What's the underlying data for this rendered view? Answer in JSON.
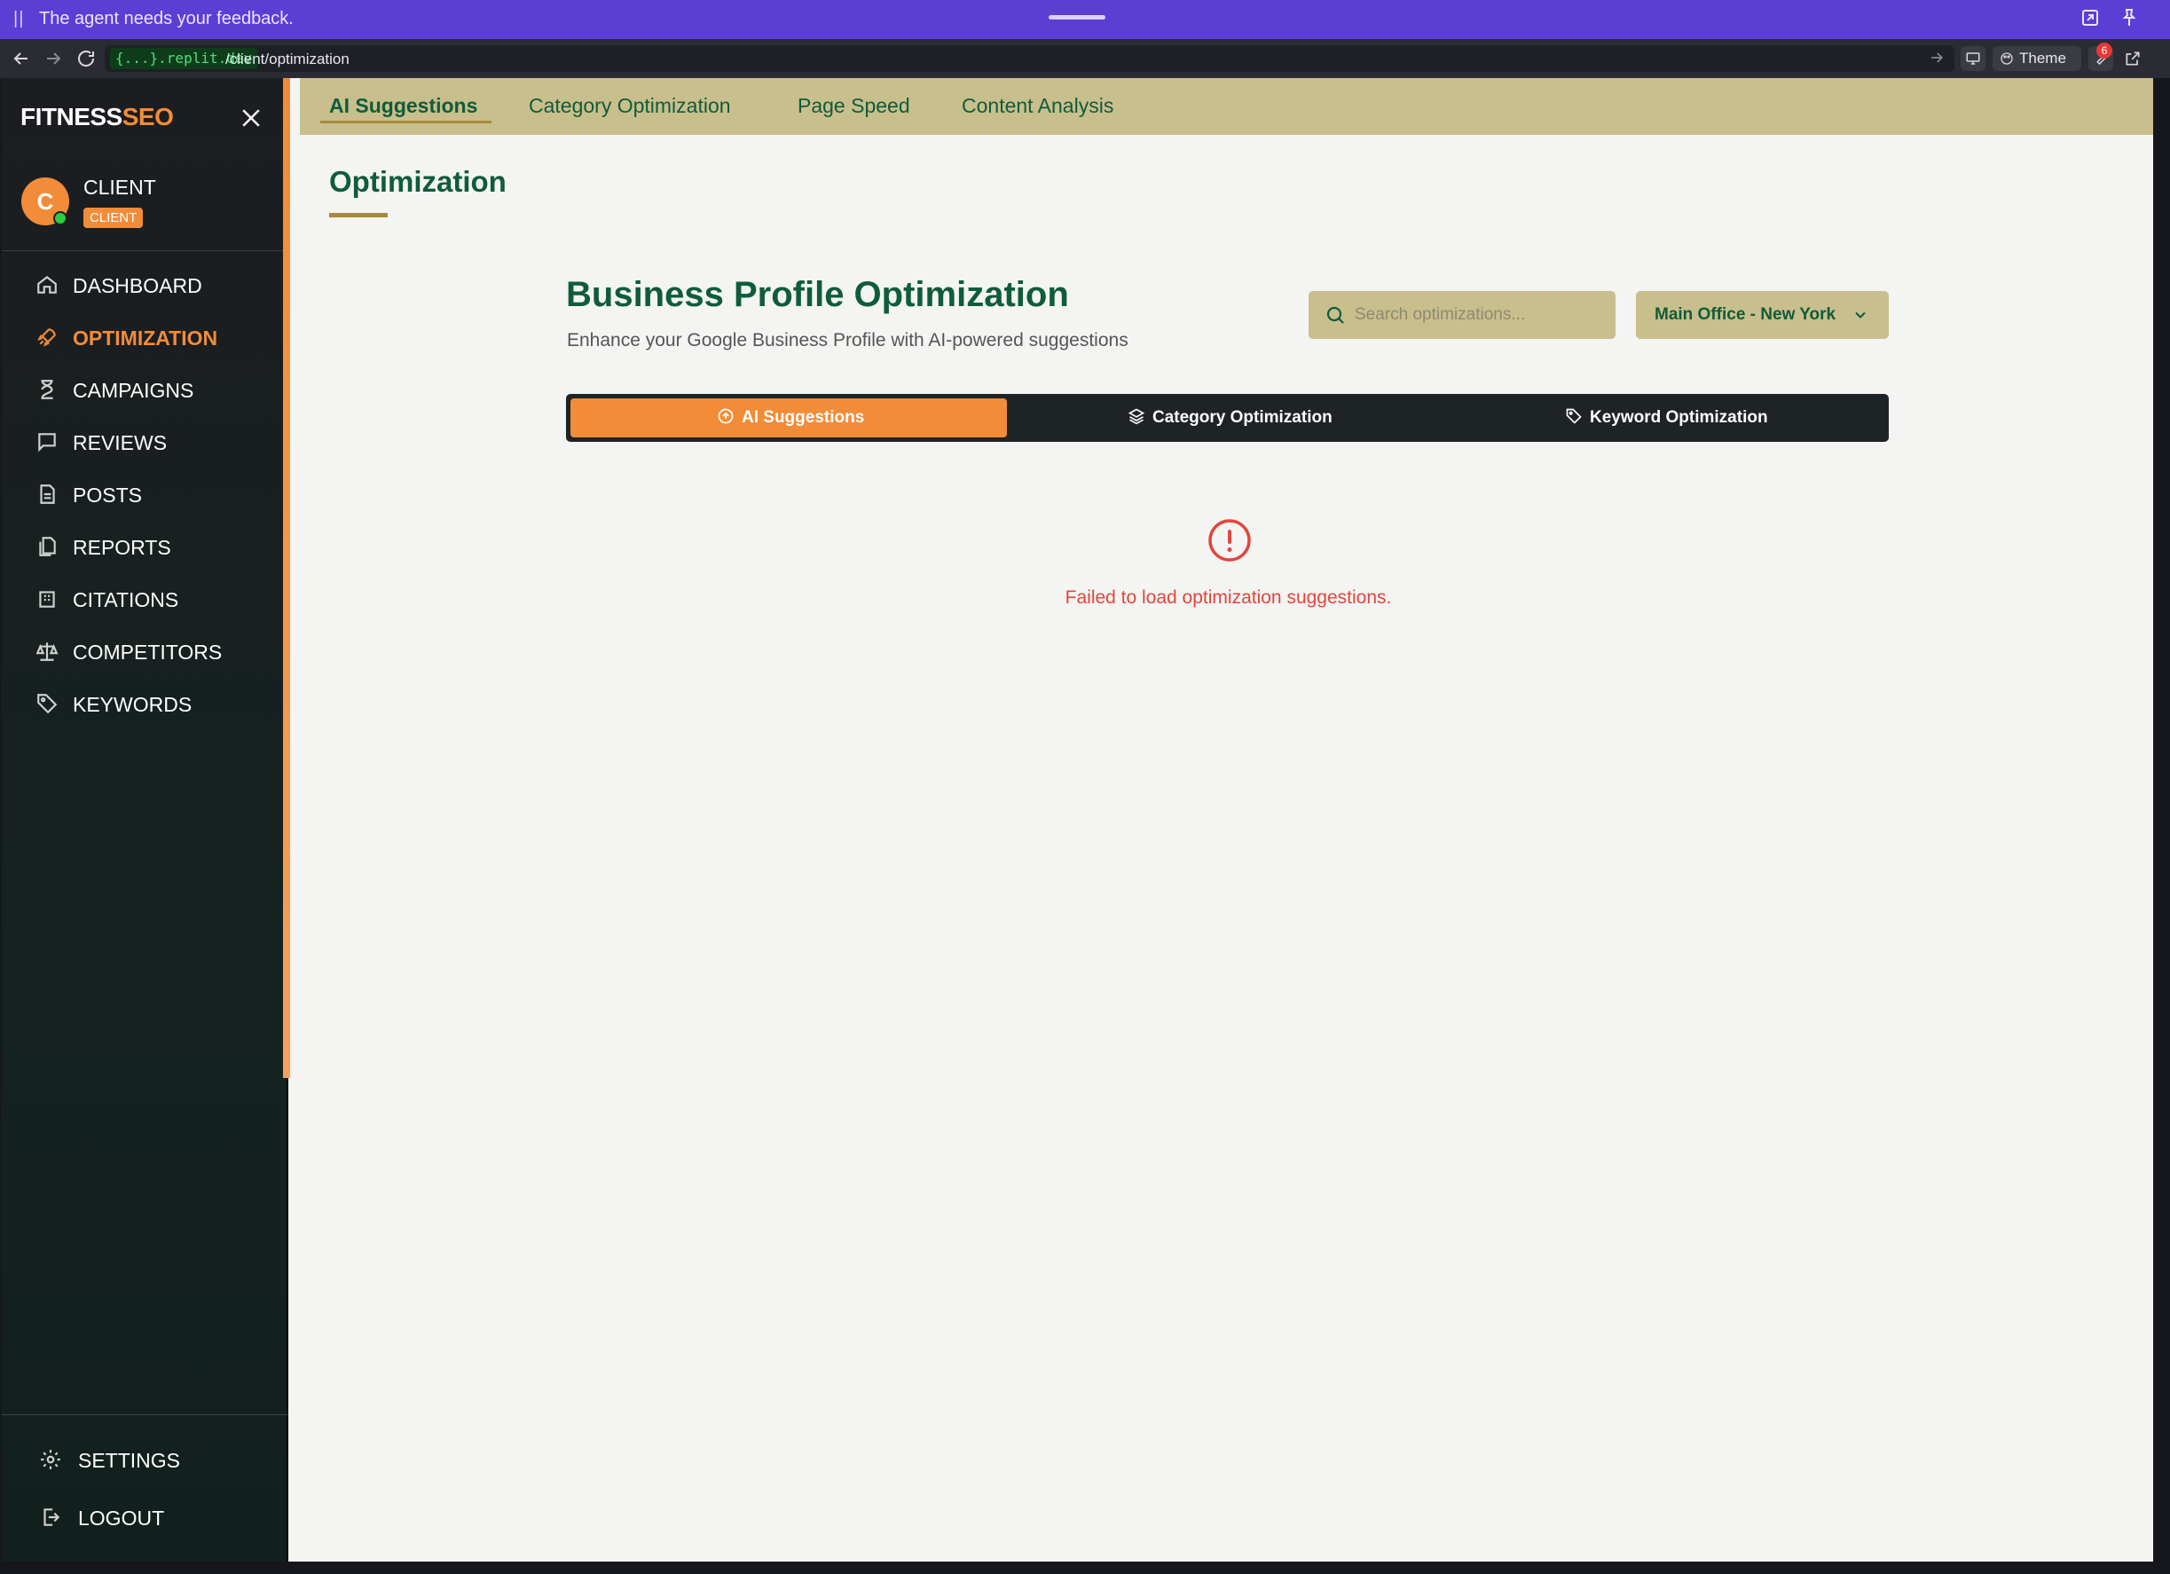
{
  "banner": {
    "message": "The agent needs your feedback."
  },
  "browser": {
    "host": "{...}.replit.dev",
    "path": "/client/optimization",
    "theme_label": "Theme",
    "notification_count": "6"
  },
  "sidebar": {
    "logo_part1": "FITNESS",
    "logo_part2": "SEO",
    "user": {
      "initial": "C",
      "name": "CLIENT",
      "role": "CLIENT"
    },
    "items": [
      {
        "label": "DASHBOARD",
        "icon": "home-icon"
      },
      {
        "label": "OPTIMIZATION",
        "icon": "rocket-icon",
        "active": true
      },
      {
        "label": "CAMPAIGNS",
        "icon": "hourglass-icon"
      },
      {
        "label": "REVIEWS",
        "icon": "message-icon"
      },
      {
        "label": "POSTS",
        "icon": "document-icon"
      },
      {
        "label": "REPORTS",
        "icon": "files-icon"
      },
      {
        "label": "CITATIONS",
        "icon": "building-icon"
      },
      {
        "label": "COMPETITORS",
        "icon": "scale-icon"
      },
      {
        "label": "KEYWORDS",
        "icon": "tag-icon"
      }
    ],
    "bottom": [
      {
        "label": "SETTINGS",
        "icon": "gear-icon"
      },
      {
        "label": "LOGOUT",
        "icon": "logout-icon"
      }
    ]
  },
  "top_tabs": [
    {
      "label": "AI Suggestions",
      "active": true
    },
    {
      "label": "Category Optimization"
    },
    {
      "label": "Page Speed"
    },
    {
      "label": "Content Analysis"
    }
  ],
  "page": {
    "title": "Optimization",
    "section_title": "Business Profile Optimization",
    "section_subtitle": "Enhance your Google Business Profile with AI-powered suggestions",
    "search_placeholder": "Search optimizations...",
    "location_selected": "Main Office - New York"
  },
  "segments": [
    {
      "label": "AI Suggestions",
      "icon": "arrow-up-circle-icon",
      "active": true
    },
    {
      "label": "Category Optimization",
      "icon": "layers-icon"
    },
    {
      "label": "Keyword Optimization",
      "icon": "tag-icon"
    }
  ],
  "error": {
    "message": "Failed to load optimization suggestions."
  },
  "colors": {
    "accent": "#f28c38",
    "brand_green": "#0f5c3a",
    "khaki": "#c8bf8d",
    "error": "#e0463e",
    "banner": "#5b3fd4"
  }
}
